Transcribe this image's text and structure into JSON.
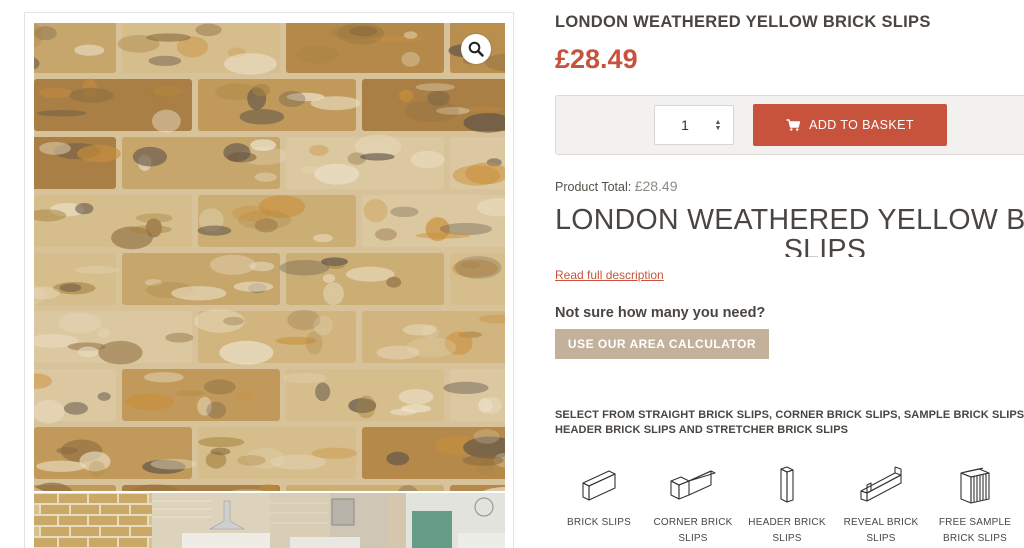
{
  "product": {
    "title": "LONDON WEATHERED YELLOW BRICK SLIPS",
    "price": "£28.49",
    "quantity": "1",
    "add_to_basket_label": "ADD TO BASKET",
    "total_label": "Product Total:",
    "total_value": "£28.49",
    "description_heading": "LONDON WEATHERED YELLOW BRICK SLIPS",
    "read_more_label": "Read full description"
  },
  "calculator": {
    "prompt": "Not sure how many you need?",
    "button_label": "USE OUR AREA CALCULATOR"
  },
  "select_text": "SELECT FROM STRAIGHT BRICK SLIPS, CORNER BRICK SLIPS, SAMPLE BRICK SLIPS, HEADER BRICK SLIPS AND STRETCHER BRICK SLIPS",
  "slip_types": [
    {
      "label_line1": "BRICK SLIPS",
      "label_line2": "",
      "icon": "brick-slip-icon"
    },
    {
      "label_line1": "CORNER BRICK",
      "label_line2": "SLIPS",
      "icon": "corner-brick-icon"
    },
    {
      "label_line1": "HEADER BRICK",
      "label_line2": "SLIPS",
      "icon": "header-brick-icon"
    },
    {
      "label_line1": "REVEAL BRICK",
      "label_line2": "SLIPS",
      "icon": "reveal-brick-icon"
    },
    {
      "label_line1": "FREE SAMPLE",
      "label_line2": "BRICK SLIPS",
      "icon": "sample-pack-icon"
    }
  ],
  "gallery": {
    "zoom_icon": "magnifier-icon",
    "thumbnails": [
      "brick-wall-thumbnail",
      "kitchen-thumbnail",
      "bathroom-thumbnail",
      "living-room-thumbnail"
    ]
  },
  "colors": {
    "accent": "#c7533c",
    "calculator_button": "#c3b19b",
    "text": "#4a4540",
    "brick_base": "#c8a56a"
  }
}
